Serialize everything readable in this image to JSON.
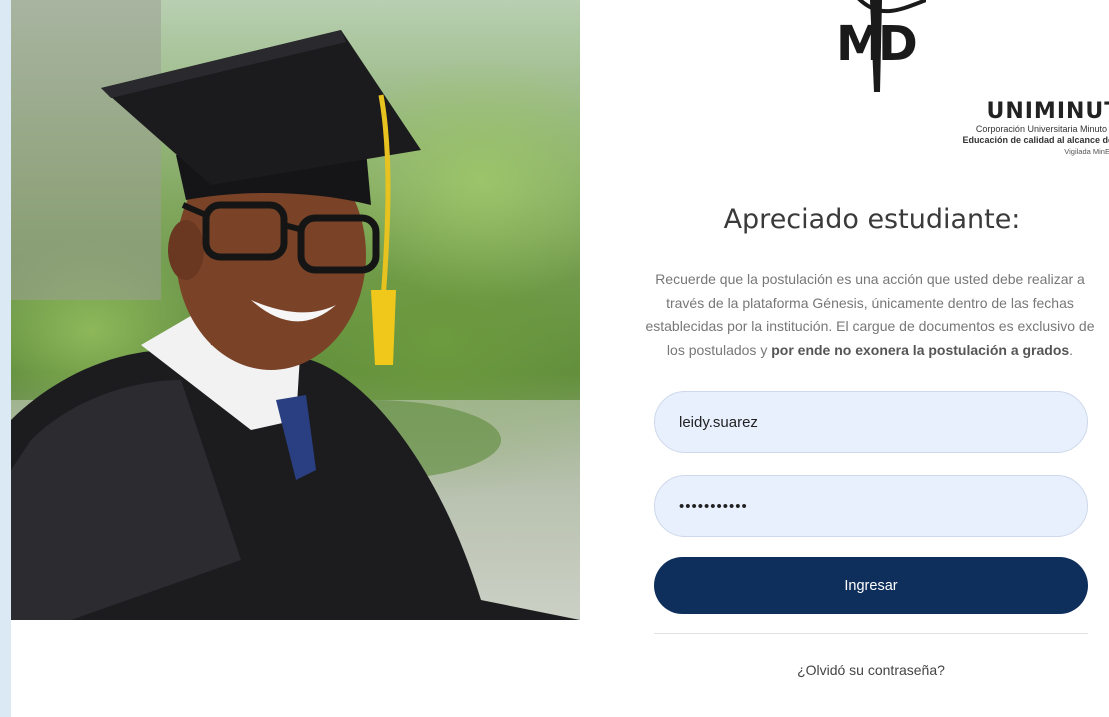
{
  "image": {
    "alt": "Graduate student wearing cap and gown"
  },
  "logo": {
    "mark": "MD",
    "name": "UNIMINUTO",
    "subtitle": "Corporación Universitaria Minuto de Dios",
    "tagline": "Educación de calidad al alcance de todos",
    "oversight": "Vigilada MinEducación"
  },
  "heading": "Apreciado estudiante:",
  "notice": {
    "text": "Recuerde que la postulación es una acción que usted debe realizar a través de la plataforma Génesis, únicamente dentro de las fechas establecidas por la institución. El cargue de documentos es exclusivo de los postulados y ",
    "emphasis": "por ende no exonera la postulación a grados",
    "end": "."
  },
  "form": {
    "username_value": "leidy.suarez",
    "password_value": "contrasena1",
    "submit_label": "Ingresar",
    "forgot_label": "¿Olvidó su contraseña?"
  },
  "colors": {
    "primary": "#0e2e5c",
    "input_bg": "#e8f0fe",
    "left_strip": "#dbe9f5"
  }
}
